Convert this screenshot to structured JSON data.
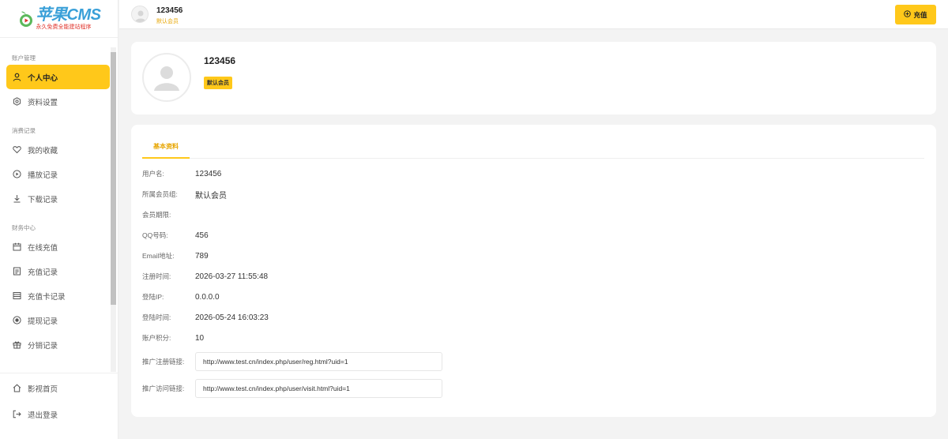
{
  "brand": {
    "logo_title": "苹果CMS",
    "logo_subtitle": "永久免费全能建站程序"
  },
  "sidebar": {
    "groups": [
      {
        "title": "账户管理",
        "items": [
          {
            "label": "个人中心",
            "icon": "user-icon",
            "active": true
          },
          {
            "label": "资料设置",
            "icon": "gear-icon"
          }
        ]
      },
      {
        "title": "消费记录",
        "items": [
          {
            "label": "我的收藏",
            "icon": "heart-icon"
          },
          {
            "label": "播放记录",
            "icon": "play-icon"
          },
          {
            "label": "下载记录",
            "icon": "download-icon"
          }
        ]
      },
      {
        "title": "财务中心",
        "items": [
          {
            "label": "在线充值",
            "icon": "calendar-icon"
          },
          {
            "label": "充值记录",
            "icon": "document-icon"
          },
          {
            "label": "充值卡记录",
            "icon": "card-icon"
          },
          {
            "label": "提现记录",
            "icon": "record-icon"
          },
          {
            "label": "分销记录",
            "icon": "gift-icon"
          }
        ]
      }
    ],
    "bottom": [
      {
        "label": "影视首页",
        "icon": "home-icon"
      },
      {
        "label": "退出登录",
        "icon": "logout-icon"
      }
    ]
  },
  "header": {
    "username": "123456",
    "level": "默认会员",
    "recharge_label": "充值"
  },
  "profile": {
    "username": "123456",
    "badge": "默认会员"
  },
  "info": {
    "tab": "基本资料",
    "rows": [
      {
        "label": "用户名:",
        "value": "123456"
      },
      {
        "label": "所属会员组:",
        "value": "默认会员"
      },
      {
        "label": "会员期限:",
        "value": ""
      },
      {
        "label": "QQ号码:",
        "value": "456"
      },
      {
        "label": "Email地址:",
        "value": "789"
      },
      {
        "label": "注册时间:",
        "value": "2026-03-27 11:55:48"
      },
      {
        "label": "登陆IP:",
        "value": "0.0.0.0"
      },
      {
        "label": "登陆时间:",
        "value": "2026-05-24 16:03:23"
      },
      {
        "label": "账户积分:",
        "value": "10"
      }
    ],
    "links": [
      {
        "label": "推广注册链接:",
        "value": "http://www.test.cn/index.php/user/reg.html?uid=1"
      },
      {
        "label": "推广访问链接:",
        "value": "http://www.test.cn/index.php/user/visit.html?uid=1"
      }
    ]
  },
  "colors": {
    "accent": "#ffc81a",
    "accent_text": "#e7a500",
    "background": "#f3f3f3"
  }
}
